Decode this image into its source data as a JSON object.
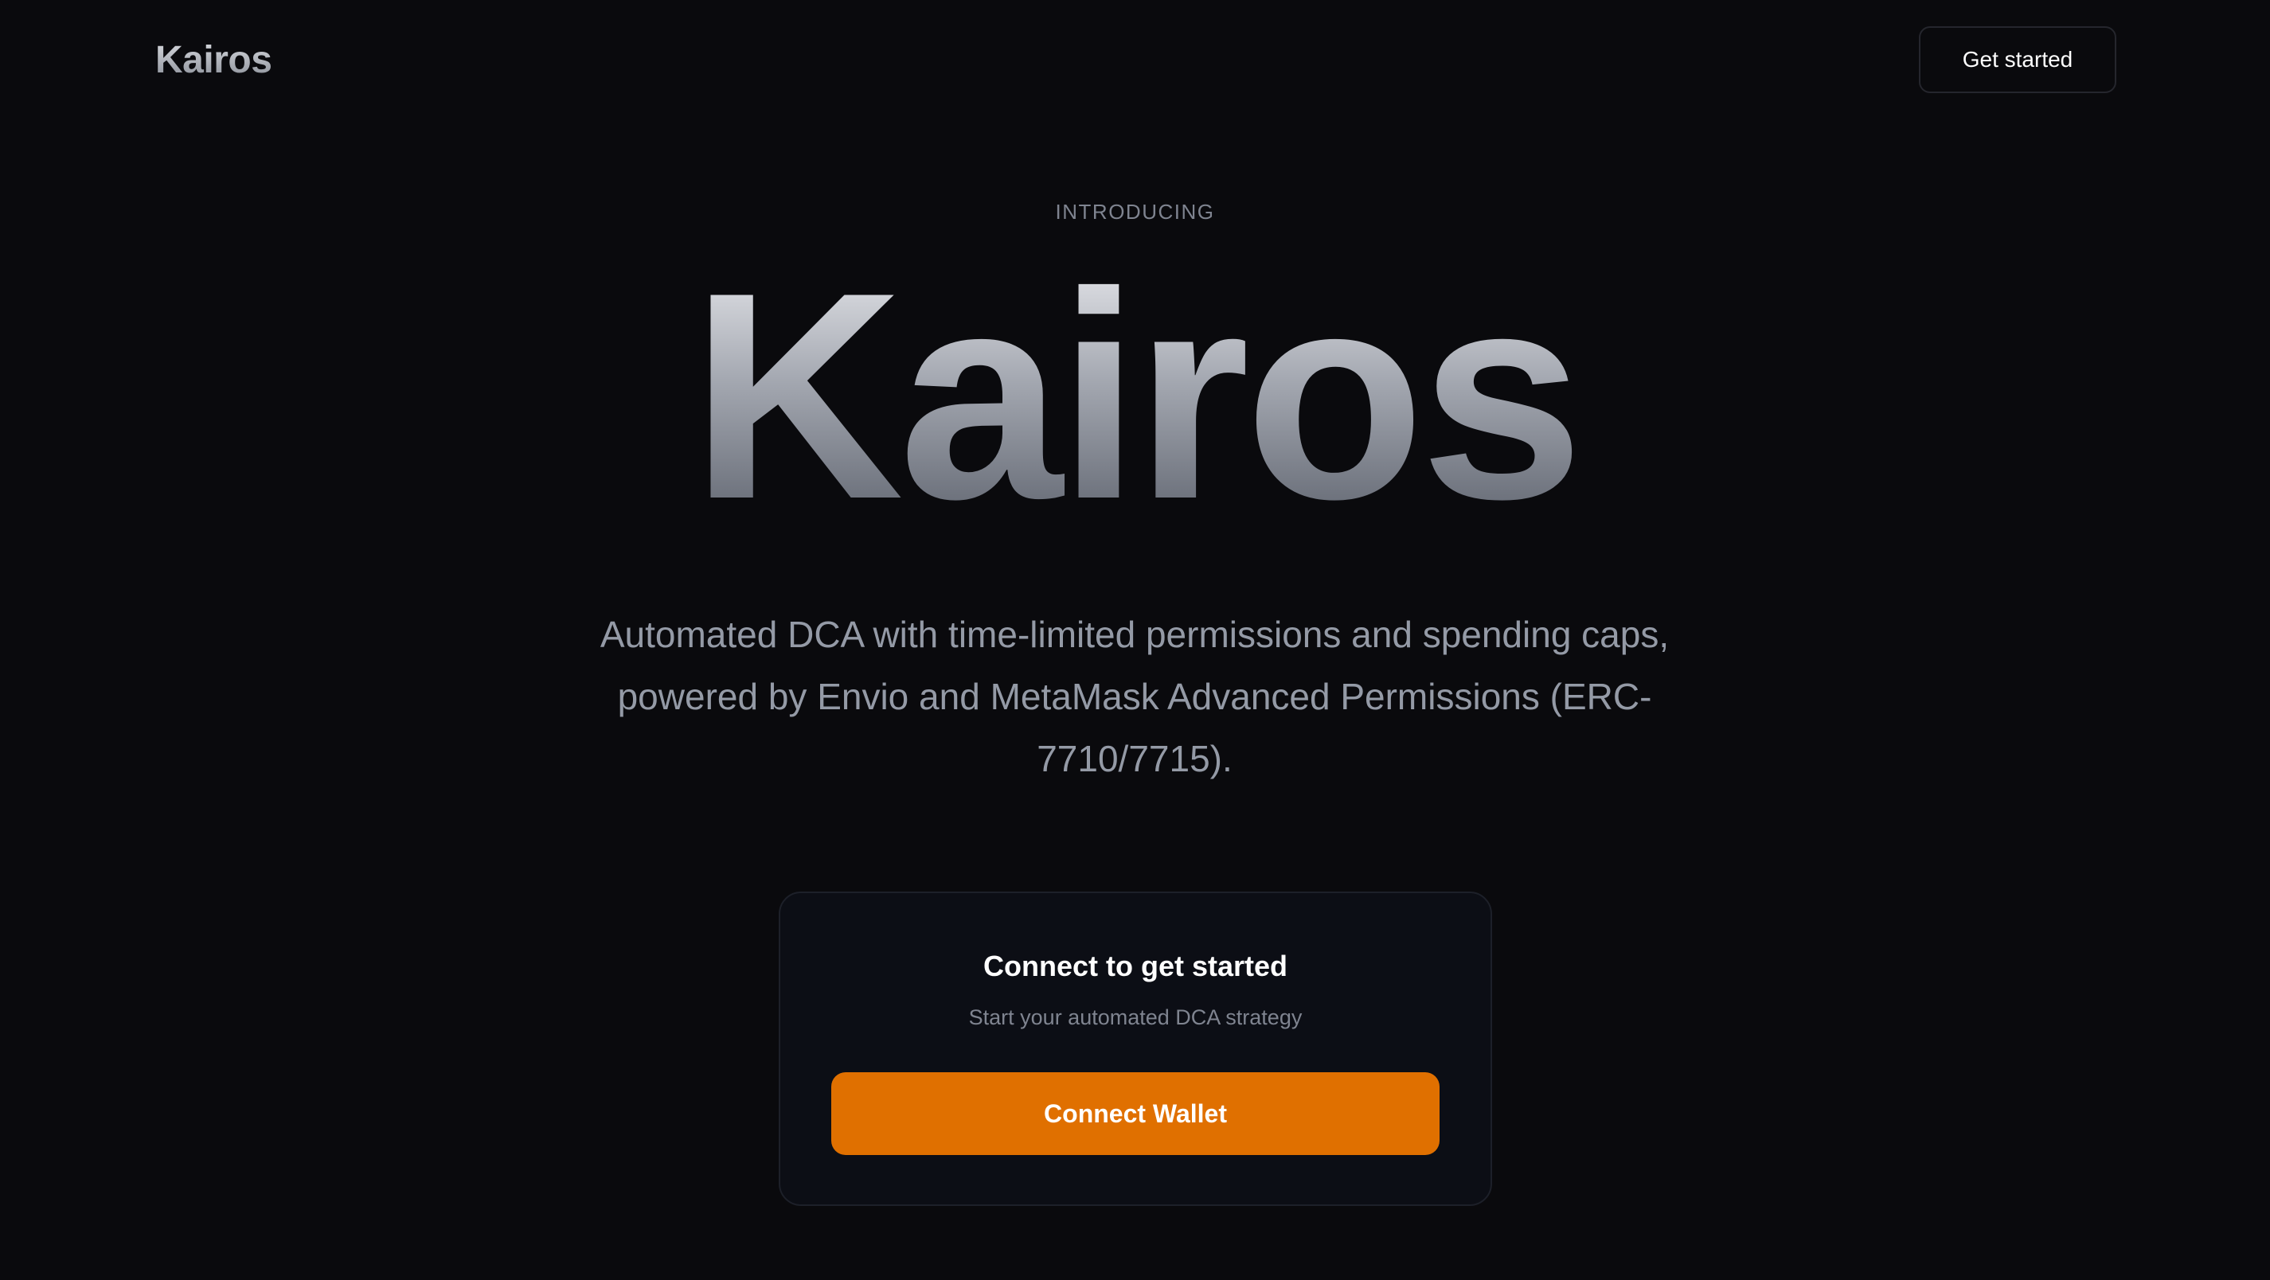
{
  "header": {
    "logo": "Kairos",
    "cta_label": "Get started"
  },
  "hero": {
    "eyebrow": "INTRODUCING",
    "title": "Kairos",
    "subtitle": "Automated DCA with time-limited permissions and spending caps, powered by Envio and MetaMask Advanced Permissions (ERC-7710/7715)."
  },
  "connect_card": {
    "title": "Connect to get started",
    "subtitle": "Start your automated DCA strategy",
    "button_label": "Connect Wallet"
  },
  "colors": {
    "background": "#0a0a0d",
    "accent": "#e07000",
    "card_background": "#0c0e15",
    "muted_text": "#7f8490"
  }
}
